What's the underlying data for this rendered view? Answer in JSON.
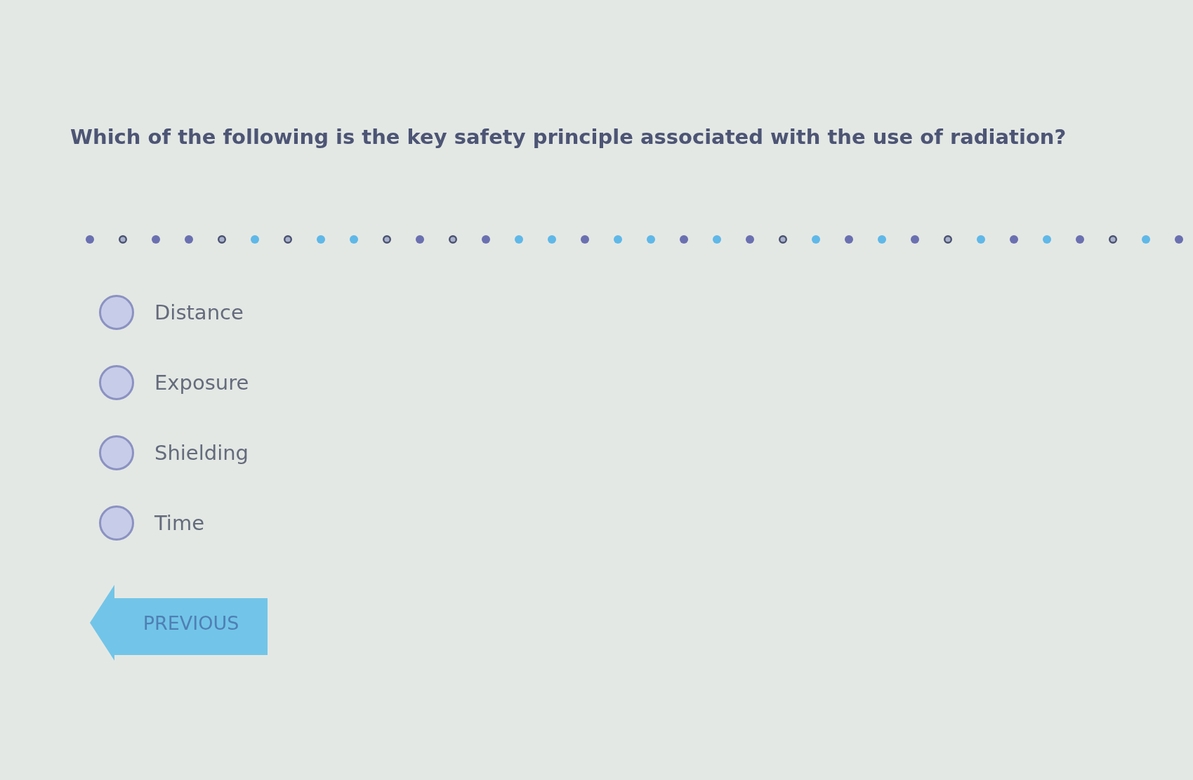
{
  "question": {
    "text": "Which of the following is the key safety principle associated with the use of radiation?"
  },
  "progress_dots": [
    {
      "kind": "dot",
      "color": "#6a70b0"
    },
    {
      "kind": "ring",
      "color": "#4a5270"
    },
    {
      "kind": "dot",
      "color": "#6a70b0"
    },
    {
      "kind": "dot",
      "color": "#6a70b0"
    },
    {
      "kind": "ring",
      "color": "#4a5270"
    },
    {
      "kind": "dot",
      "color": "#5fb8e8"
    },
    {
      "kind": "ring",
      "color": "#4a5270"
    },
    {
      "kind": "dot",
      "color": "#5fb8e8"
    },
    {
      "kind": "dot",
      "color": "#5fb8e8"
    },
    {
      "kind": "ring",
      "color": "#4a5270"
    },
    {
      "kind": "dot",
      "color": "#6a70b0"
    },
    {
      "kind": "ring",
      "color": "#4a5270"
    },
    {
      "kind": "dot",
      "color": "#6a70b0"
    },
    {
      "kind": "dot",
      "color": "#5fb8e8"
    },
    {
      "kind": "dot",
      "color": "#5fb8e8"
    },
    {
      "kind": "dot",
      "color": "#6a70b0"
    },
    {
      "kind": "dot",
      "color": "#5fb8e8"
    },
    {
      "kind": "dot",
      "color": "#5fb8e8"
    },
    {
      "kind": "dot",
      "color": "#6a70b0"
    },
    {
      "kind": "dot",
      "color": "#5fb8e8"
    },
    {
      "kind": "dot",
      "color": "#6a70b0"
    },
    {
      "kind": "ring",
      "color": "#4a5270"
    },
    {
      "kind": "dot",
      "color": "#5fb8e8"
    },
    {
      "kind": "dot",
      "color": "#6a70b0"
    },
    {
      "kind": "dot",
      "color": "#5fb8e8"
    },
    {
      "kind": "dot",
      "color": "#6a70b0"
    },
    {
      "kind": "ring",
      "color": "#4a5270"
    },
    {
      "kind": "dot",
      "color": "#5fb8e8"
    },
    {
      "kind": "dot",
      "color": "#6a70b0"
    },
    {
      "kind": "dot",
      "color": "#5fb8e8"
    },
    {
      "kind": "dot",
      "color": "#6a70b0"
    },
    {
      "kind": "ring",
      "color": "#4a5270"
    },
    {
      "kind": "dot",
      "color": "#5fb8e8"
    },
    {
      "kind": "dot",
      "color": "#6a70b0"
    }
  ],
  "options": [
    {
      "label": "Distance",
      "selected": false
    },
    {
      "label": "Exposure",
      "selected": false
    },
    {
      "label": "Shielding",
      "selected": false
    },
    {
      "label": "Time",
      "selected": false
    }
  ],
  "buttons": [
    {
      "label": "PREVIOUS",
      "kind": "back"
    }
  ]
}
